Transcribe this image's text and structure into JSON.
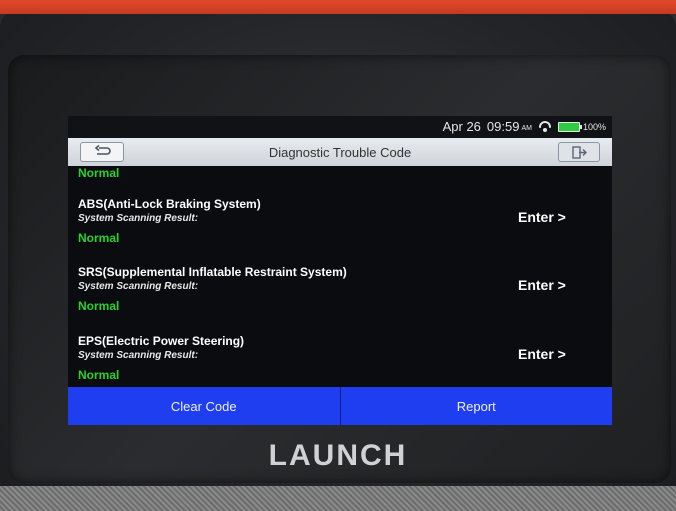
{
  "device": {
    "brand": "LAUNCH"
  },
  "statusbar": {
    "date": "Apr 26",
    "time": "09:59",
    "ampm": "AM",
    "battery": "100%",
    "icons": [
      "wifi-icon",
      "battery-icon"
    ]
  },
  "titlebar": {
    "title": "Diagnostic Trouble Code",
    "back_icon": "back-arrow-icon",
    "exit_icon": "exit-icon"
  },
  "content": {
    "top_status": "Normal",
    "systems": [
      {
        "name": "ABS(Anti-Lock Braking System)",
        "sub": "System Scanning Result:",
        "status": "Normal",
        "action": "Enter >"
      },
      {
        "name": "SRS(Supplemental Inflatable Restraint System)",
        "sub": "System Scanning Result:",
        "status": "Normal",
        "action": "Enter >"
      },
      {
        "name": "EPS(Electric Power Steering)",
        "sub": "System Scanning Result:",
        "status": "Normal",
        "action": "Enter >"
      }
    ]
  },
  "buttons": {
    "clear": "Clear Code",
    "report": "Report"
  },
  "colors": {
    "normal": "#29d12b",
    "button": "#1f3ef0",
    "accent_shell": "#d9432a"
  }
}
